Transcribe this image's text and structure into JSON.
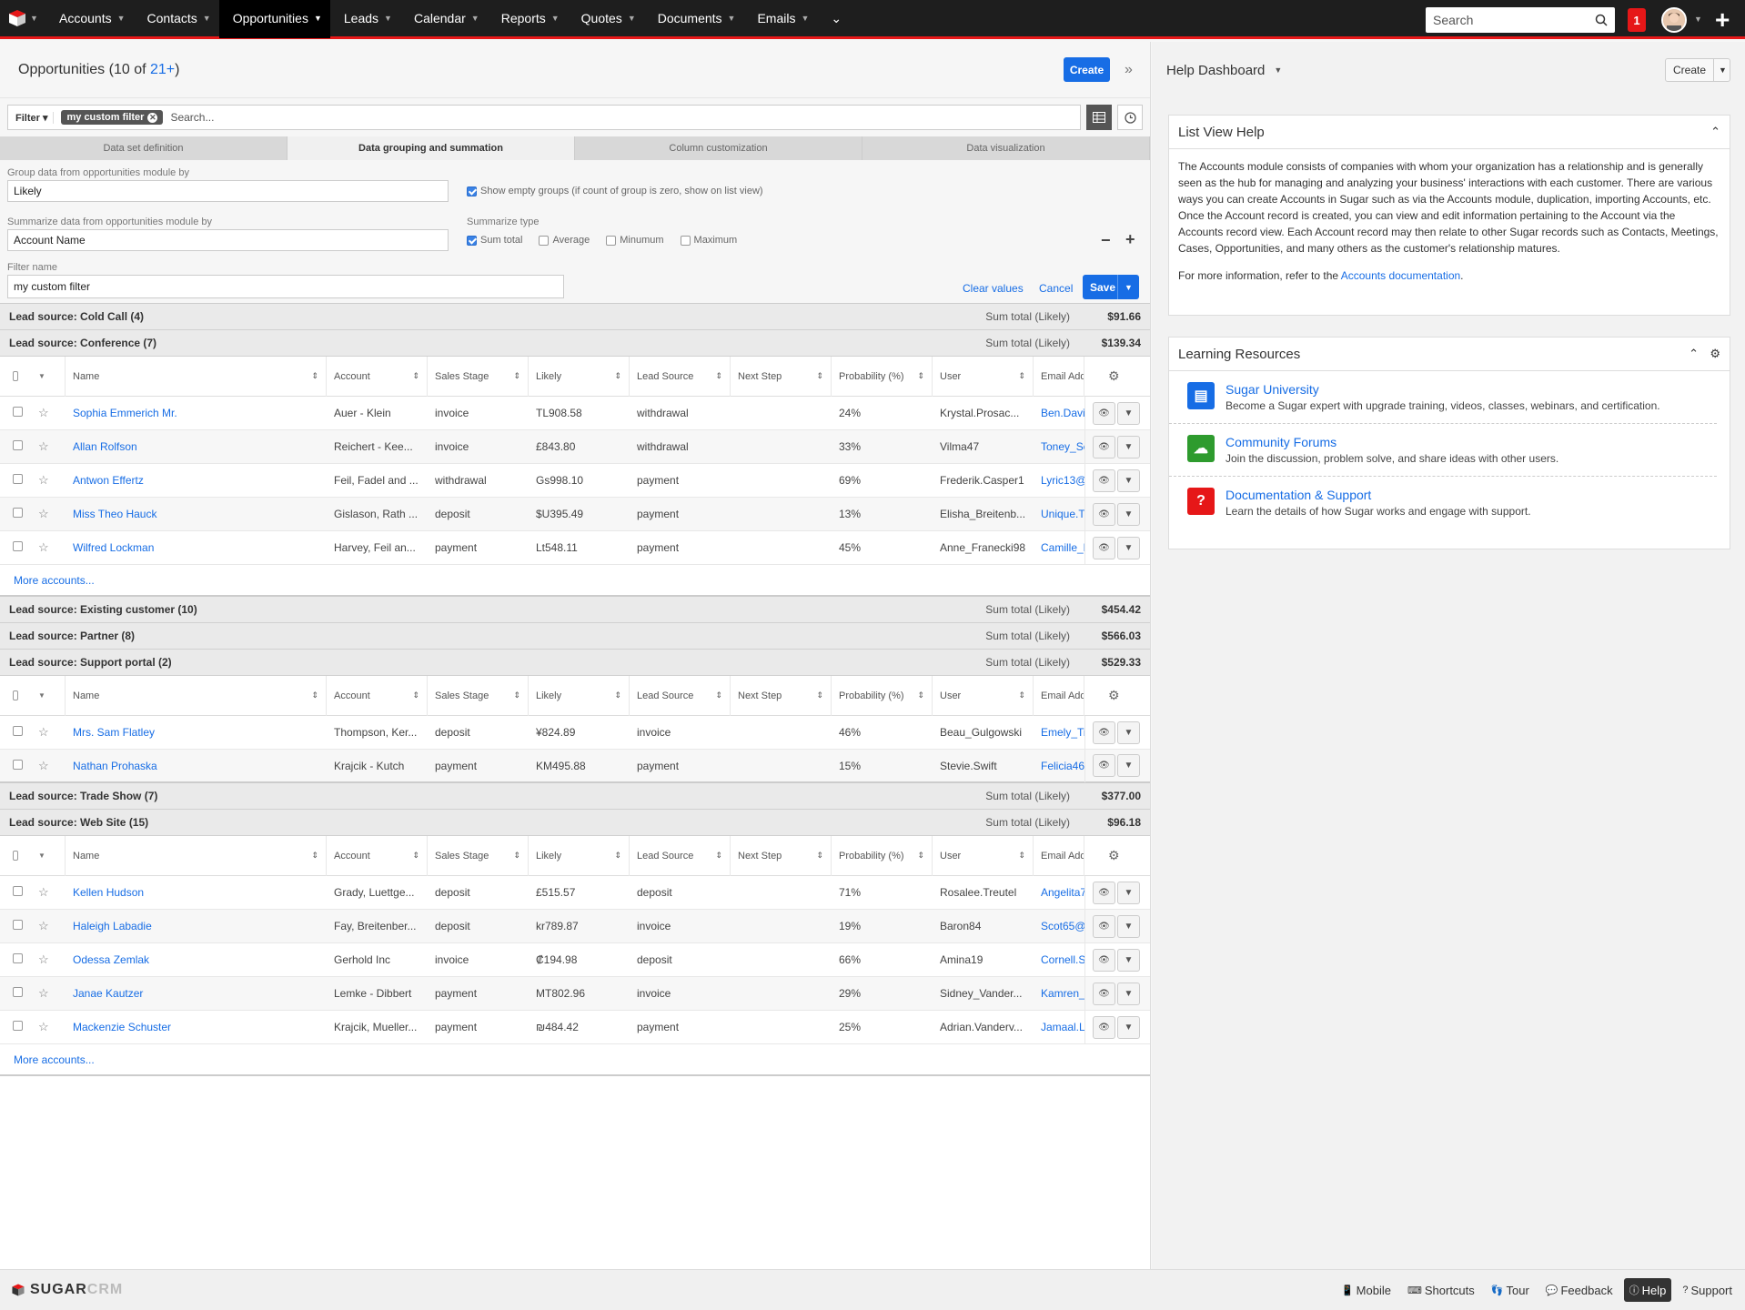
{
  "nav": {
    "items": [
      {
        "label": "Accounts"
      },
      {
        "label": "Contacts"
      },
      {
        "label": "Opportunities",
        "active": true
      },
      {
        "label": "Leads"
      },
      {
        "label": "Calendar"
      },
      {
        "label": "Reports"
      },
      {
        "label": "Quotes"
      },
      {
        "label": "Documents"
      },
      {
        "label": "Emails"
      }
    ],
    "search_placeholder": "Search",
    "notifications": "1",
    "brand_color": "#e61718"
  },
  "header": {
    "title": "Opportunities",
    "count_prefix": "(10 of ",
    "count_link": "21+",
    "count_suffix": ")",
    "create_label": "Create"
  },
  "filter": {
    "label": "Filter",
    "chip": "my custom filter",
    "search_placeholder": "Search..."
  },
  "tabs": [
    {
      "label": "Data set definition"
    },
    {
      "label": "Data grouping and summation",
      "active": true
    },
    {
      "label": "Column customization"
    },
    {
      "label": "Data visualization"
    }
  ],
  "config": {
    "group_label": "Group data from opportunities module by",
    "group_value": "Likely",
    "show_empty_label": "Show empty groups (if count of group is zero, show on list view)",
    "summarize_label": "Summarize data from opportunities module by",
    "summarize_value": "Account Name",
    "summarize_type_label": "Summarize type",
    "types": [
      {
        "label": "Sum total",
        "checked": true
      },
      {
        "label": "Average",
        "checked": false
      },
      {
        "label": "Minumum",
        "checked": false
      },
      {
        "label": "Maximum",
        "checked": false
      }
    ],
    "filter_name_label": "Filter name",
    "filter_name_value": "my custom filter",
    "clear_label": "Clear values",
    "cancel_label": "Cancel",
    "save_label": "Save"
  },
  "columns": [
    "Name",
    "Account",
    "Sales Stage",
    "Likely",
    "Lead Source",
    "Next Step",
    "Probability (%)",
    "User",
    "Email Add"
  ],
  "sum_label": "Sum total (Likely)",
  "more_label": "More accounts...",
  "groups": [
    {
      "title": "Lead source: Cold Call (4)",
      "amount": "$91.66",
      "rows": []
    },
    {
      "title": "Lead source: Conference (7)",
      "amount": "$139.34",
      "more": true,
      "rows": [
        {
          "name": "Sophia Emmerich Mr.",
          "account": "Auer - Klein",
          "stage": "invoice",
          "likely": "TL908.58",
          "source": "withdrawal",
          "next": "",
          "prob": "24%",
          "user": "Krystal.Prosac...",
          "email": "Ben.Davi"
        },
        {
          "name": "Allan Rolfson",
          "account": "Reichert - Kee...",
          "stage": "invoice",
          "likely": "£843.80",
          "source": "withdrawal",
          "next": "",
          "prob": "33%",
          "user": "Vilma47",
          "email": "Toney_Sc"
        },
        {
          "name": "Antwon Effertz",
          "account": "Feil, Fadel and ...",
          "stage": "withdrawal",
          "likely": "Gs998.10",
          "source": "payment",
          "next": "",
          "prob": "69%",
          "user": "Frederik.Casper1",
          "email": "Lyric13@"
        },
        {
          "name": "Miss Theo Hauck",
          "account": "Gislason, Rath ...",
          "stage": "deposit",
          "likely": "$U395.49",
          "source": "payment",
          "next": "",
          "prob": "13%",
          "user": "Elisha_Breitenb...",
          "email": "Unique.T"
        },
        {
          "name": "Wilfred Lockman",
          "account": "Harvey, Feil an...",
          "stage": "payment",
          "likely": "Lt548.11",
          "source": "payment",
          "next": "",
          "prob": "45%",
          "user": "Anne_Franecki98",
          "email": "Camille_M"
        }
      ]
    },
    {
      "title": "Lead source: Existing customer (10)",
      "amount": "$454.42",
      "rows": []
    },
    {
      "title": "Lead source: Partner (8)",
      "amount": "$566.03",
      "rows": []
    },
    {
      "title": "Lead source: Support portal (2)",
      "amount": "$529.33",
      "rows": [
        {
          "name": "Mrs. Sam Flatley",
          "account": "Thompson, Ker...",
          "stage": "deposit",
          "likely": "¥824.89",
          "source": "invoice",
          "next": "",
          "prob": "46%",
          "user": "Beau_Gulgowski",
          "email": "Emely_Ti"
        },
        {
          "name": "Nathan Prohaska",
          "account": "Krajcik - Kutch",
          "stage": "payment",
          "likely": "KM495.88",
          "source": "payment",
          "next": "",
          "prob": "15%",
          "user": "Stevie.Swift",
          "email": "Felicia46"
        }
      ]
    },
    {
      "title": "Lead source: Trade Show (7)",
      "amount": "$377.00",
      "rows": []
    },
    {
      "title": "Lead source: Web Site (15)",
      "amount": "$96.18",
      "more": true,
      "rows": [
        {
          "name": "Kellen Hudson",
          "account": "Grady, Luettge...",
          "stage": "deposit",
          "likely": "£515.57",
          "source": "deposit",
          "next": "",
          "prob": "71%",
          "user": "Rosalee.Treutel",
          "email": "Angelita7"
        },
        {
          "name": "Haleigh Labadie",
          "account": "Fay, Breitenber...",
          "stage": "deposit",
          "likely": "kr789.87",
          "source": "invoice",
          "next": "",
          "prob": "19%",
          "user": "Baron84",
          "email": "Scot65@"
        },
        {
          "name": "Odessa Zemlak",
          "account": "Gerhold Inc",
          "stage": "invoice",
          "likely": "₡194.98",
          "source": "deposit",
          "next": "",
          "prob": "66%",
          "user": "Amina19",
          "email": "Cornell.S"
        },
        {
          "name": "Janae Kautzer",
          "account": "Lemke - Dibbert",
          "stage": "payment",
          "likely": "MT802.96",
          "source": "invoice",
          "next": "",
          "prob": "29%",
          "user": "Sidney_Vander...",
          "email": "Kamren_"
        },
        {
          "name": "Mackenzie Schuster",
          "account": "Krajcik, Mueller...",
          "stage": "payment",
          "likely": "₪484.42",
          "source": "payment",
          "next": "",
          "prob": "25%",
          "user": "Adrian.Vanderv...",
          "email": "Jamaal.L"
        }
      ]
    }
  ],
  "sidebar": {
    "title": "Help Dashboard",
    "create_label": "Create",
    "help_title": "List View Help",
    "help_text": "The Accounts module consists of companies with whom your organization has a relationship and is generally seen as the hub for managing and analyzing your business' interactions with each customer. There are various ways you can create Accounts in Sugar such as via the Accounts module, duplication, importing Accounts, etc. Once the Account record is created, you can view and edit information pertaining to the Account via the Accounts record view. Each Account record may then relate to other Sugar records such as Contacts, Meetings, Cases, Opportunities, and many others as the customer's relationship matures.",
    "help_more_prefix": "For more information, refer to the ",
    "help_more_link": "Accounts documentation",
    "help_more_suffix": ".",
    "lr_title": "Learning Resources",
    "resources": [
      {
        "title": "Sugar University",
        "desc": "Become a Sugar expert with upgrade training, videos, classes, webinars, and certification.",
        "color": "#176de5",
        "icon": "book-icon"
      },
      {
        "title": "Community Forums",
        "desc": "Join the discussion, problem solve, and share ideas with other users.",
        "color": "#2e9b2e",
        "icon": "chat-icon"
      },
      {
        "title": "Documentation & Support",
        "desc": "Learn the details of how Sugar works and engage with support.",
        "color": "#e61718",
        "icon": "question-icon"
      }
    ]
  },
  "footer": {
    "logo_sugar": "SUGAR",
    "logo_crm": "CRM",
    "links": [
      {
        "label": "Mobile"
      },
      {
        "label": "Shortcuts"
      },
      {
        "label": "Tour"
      },
      {
        "label": "Feedback"
      },
      {
        "label": "Help",
        "active": true
      },
      {
        "label": "Support"
      }
    ]
  }
}
